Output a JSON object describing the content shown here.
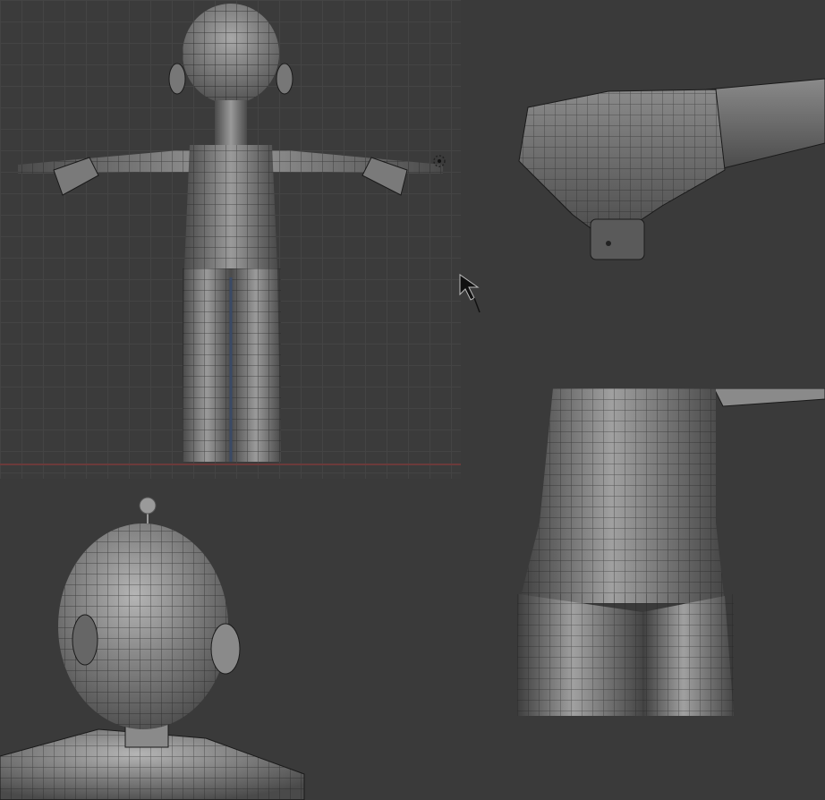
{
  "workspace": {
    "background": "#3a3a3a",
    "grid_color": "#444444",
    "mesh_fill": "#6e6e6e",
    "wire_color": "#1a1a1a",
    "floor_line_color": "#6b3a3a"
  },
  "viewports": [
    {
      "name": "front-view",
      "content": "full-body-tpose-mesh"
    },
    {
      "name": "fist-closeup",
      "content": "hand-fist-mesh"
    },
    {
      "name": "head-perspective",
      "content": "head-shoulders-mesh"
    },
    {
      "name": "hip-closeup",
      "content": "hip-legs-mesh"
    }
  ],
  "icons": [
    "mouse-cursor-icon",
    "pivot-gizmo-icon",
    "head-bone-handle-icon"
  ]
}
